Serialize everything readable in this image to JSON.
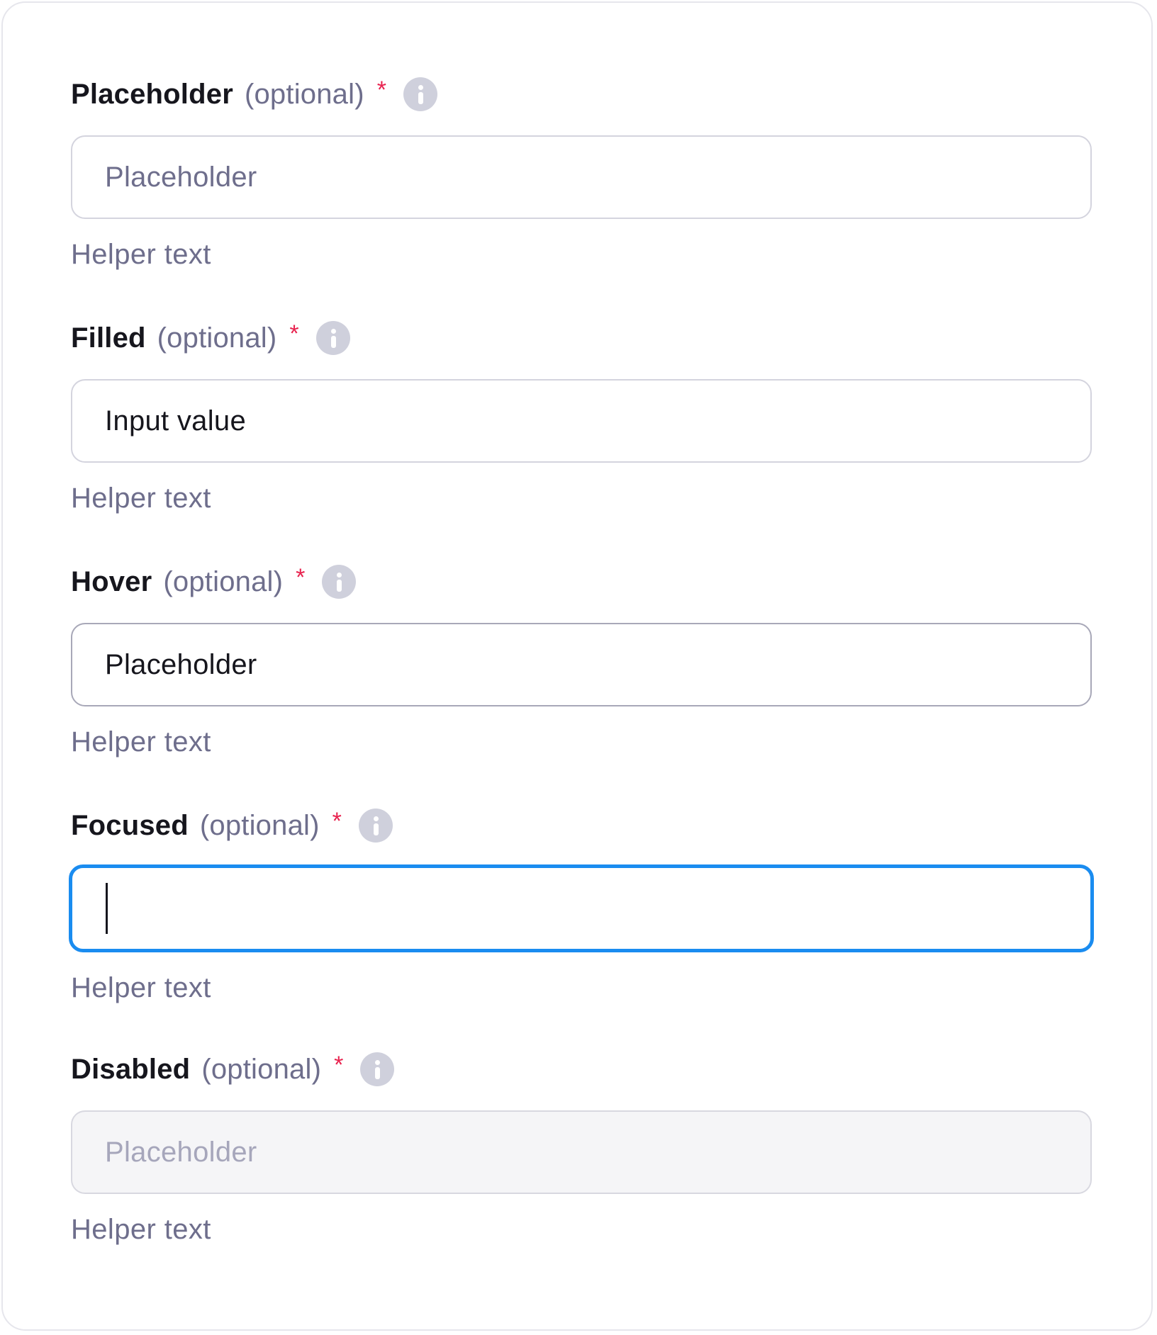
{
  "fields": [
    {
      "label": "Placeholder",
      "optional": "(optional)",
      "required": "*",
      "icon": "info-icon",
      "state": "placeholder",
      "placeholder": "Placeholder",
      "value": "",
      "helper": "Helper text"
    },
    {
      "label": "Filled",
      "optional": "(optional)",
      "required": "*",
      "icon": "info-icon",
      "state": "filled",
      "placeholder": "",
      "value": "Input value",
      "helper": "Helper text"
    },
    {
      "label": "Hover",
      "optional": "(optional)",
      "required": "*",
      "icon": "info-icon",
      "state": "hover",
      "placeholder": "",
      "value": "Placeholder",
      "helper": "Helper text"
    },
    {
      "label": "Focused",
      "optional": "(optional)",
      "required": "*",
      "icon": "info-icon",
      "state": "focused",
      "placeholder": "",
      "value": "",
      "helper": "Helper text"
    },
    {
      "label": "Disabled",
      "optional": "(optional)",
      "required": "*",
      "icon": "info-icon",
      "state": "disabled",
      "placeholder": "Placeholder",
      "value": "",
      "helper": "Helper text"
    }
  ],
  "colors": {
    "required": "#e8234f",
    "focus_border": "#1a8cf0",
    "label": "#16161d",
    "secondary_text": "#6e6e8c",
    "disabled_background": "#f5f5f7"
  }
}
